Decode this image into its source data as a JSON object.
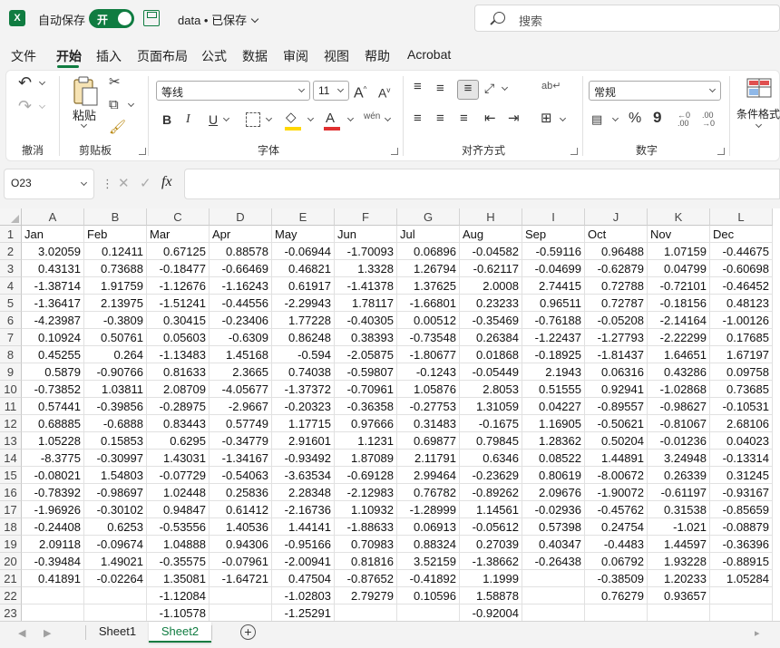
{
  "titlebar": {
    "app_icon": "excel-icon",
    "autosave_label": "自动保存",
    "toggle_label": "开",
    "doc_title": "data • 已保存",
    "search_placeholder": "搜索"
  },
  "menu": [
    "文件",
    "开始",
    "插入",
    "页面布局",
    "公式",
    "数据",
    "审阅",
    "视图",
    "帮助",
    "Acrobat"
  ],
  "ribbon": {
    "groups": {
      "undo": "撤消",
      "clipboard": "剪贴板",
      "font": "字体",
      "alignment": "对齐方式",
      "number": "数字"
    },
    "paste_label": "粘贴",
    "font_name": "等线",
    "font_size": "11",
    "number_format": "常规",
    "conditional_format": "条件格式",
    "bold": "B",
    "italic": "I",
    "underline": "U",
    "phonetic": "wén",
    "percent": "%",
    "comma": "9",
    "font_grow": "A",
    "font_shrink": "A",
    "font_color_glyph": "A",
    "decimal_increase": "←0 .00",
    "decimal_decrease": ".00 →0",
    "wrap_glyph": "ab"
  },
  "formula_bar": {
    "name_box": "O23",
    "fx_label": "fx",
    "formula": ""
  },
  "grid": {
    "columns": [
      "A",
      "B",
      "C",
      "D",
      "E",
      "F",
      "G",
      "H",
      "I",
      "J",
      "K",
      "L"
    ],
    "row_numbers": [
      "1",
      "2",
      "3",
      "4",
      "5",
      "6",
      "7",
      "8",
      "9",
      "10",
      "11",
      "12",
      "13",
      "14",
      "15",
      "16",
      "17",
      "18",
      "19",
      "20",
      "21",
      "22",
      "23"
    ],
    "header_row": [
      "Jan",
      "Feb",
      "Mar",
      "Apr",
      "May",
      "Jun",
      "Jul",
      "Aug",
      "Sep",
      "Oct",
      "Nov",
      "Dec"
    ],
    "rows": [
      [
        "3.02059",
        "0.12411",
        "0.67125",
        "0.88578",
        "-0.06944",
        "-1.70093",
        "0.06896",
        "-0.04582",
        "-0.59116",
        "0.96488",
        "1.07159",
        "-0.44675"
      ],
      [
        "0.43131",
        "0.73688",
        "-0.18477",
        "-0.66469",
        "0.46821",
        "1.3328",
        "1.26794",
        "-0.62117",
        "-0.04699",
        "-0.62879",
        "0.04799",
        "-0.60698"
      ],
      [
        "-1.38714",
        "1.91759",
        "-1.12676",
        "-1.16243",
        "0.61917",
        "-1.41378",
        "1.37625",
        "2.0008",
        "2.74415",
        "0.72788",
        "-0.72101",
        "-0.46452"
      ],
      [
        "-1.36417",
        "2.13975",
        "-1.51241",
        "-0.44556",
        "-2.29943",
        "1.78117",
        "-1.66801",
        "0.23233",
        "0.96511",
        "0.72787",
        "-0.18156",
        "0.48123"
      ],
      [
        "-4.23987",
        "-0.3809",
        "0.30415",
        "-0.23406",
        "1.77228",
        "-0.40305",
        "0.00512",
        "-0.35469",
        "-0.76188",
        "-0.05208",
        "-2.14164",
        "-1.00126"
      ],
      [
        "0.10924",
        "0.50761",
        "0.05603",
        "-0.6309",
        "0.86248",
        "0.38393",
        "-0.73548",
        "0.26384",
        "-1.22437",
        "-1.27793",
        "-2.22299",
        "0.17685"
      ],
      [
        "0.45255",
        "0.264",
        "-1.13483",
        "1.45168",
        "-0.594",
        "-2.05875",
        "-1.80677",
        "0.01868",
        "-0.18925",
        "-1.81437",
        "1.64651",
        "1.67197"
      ],
      [
        "0.5879",
        "-0.90766",
        "0.81633",
        "2.3665",
        "0.74038",
        "-0.59807",
        "-0.1243",
        "-0.05449",
        "2.1943",
        "0.06316",
        "0.43286",
        "0.09758"
      ],
      [
        "-0.73852",
        "1.03811",
        "2.08709",
        "-4.05677",
        "-1.37372",
        "-0.70961",
        "1.05876",
        "2.8053",
        "0.51555",
        "0.92941",
        "-1.02868",
        "0.73685"
      ],
      [
        "0.57441",
        "-0.39856",
        "-0.28975",
        "-2.9667",
        "-0.20323",
        "-0.36358",
        "-0.27753",
        "1.31059",
        "0.04227",
        "-0.89557",
        "-0.98627",
        "-0.10531"
      ],
      [
        "0.68885",
        "-0.6888",
        "0.83443",
        "0.57749",
        "1.17715",
        "0.97666",
        "0.31483",
        "-0.1675",
        "1.16905",
        "-0.50621",
        "-0.81067",
        "2.68106"
      ],
      [
        "1.05228",
        "0.15853",
        "0.6295",
        "-0.34779",
        "2.91601",
        "1.1231",
        "0.69877",
        "0.79845",
        "1.28362",
        "0.50204",
        "-0.01236",
        "0.04023"
      ],
      [
        "-8.3775",
        "-0.30997",
        "1.43031",
        "-1.34167",
        "-0.93492",
        "1.87089",
        "2.11791",
        "0.6346",
        "0.08522",
        "1.44891",
        "3.24948",
        "-0.13314"
      ],
      [
        "-0.08021",
        "1.54803",
        "-0.07729",
        "-0.54063",
        "-3.63534",
        "-0.69128",
        "2.99464",
        "-0.23629",
        "0.80619",
        "-8.00672",
        "0.26339",
        "0.31245"
      ],
      [
        "-0.78392",
        "-0.98697",
        "1.02448",
        "0.25836",
        "2.28348",
        "-2.12983",
        "0.76782",
        "-0.89262",
        "2.09676",
        "-1.90072",
        "-0.61197",
        "-0.93167"
      ],
      [
        "-1.96926",
        "-0.30102",
        "0.94847",
        "0.61412",
        "-2.16736",
        "1.10932",
        "-1.28999",
        "1.14561",
        "-0.02936",
        "-0.45762",
        "0.31538",
        "-0.85659"
      ],
      [
        "-0.24408",
        "0.6253",
        "-0.53556",
        "1.40536",
        "1.44141",
        "-1.88633",
        "0.06913",
        "-0.05612",
        "0.57398",
        "0.24754",
        "-1.021",
        "-0.08879"
      ],
      [
        "2.09118",
        "-0.09674",
        "1.04888",
        "0.94306",
        "-0.95166",
        "0.70983",
        "0.88324",
        "0.27039",
        "0.40347",
        "-0.4483",
        "1.44597",
        "-0.36396"
      ],
      [
        "-0.39484",
        "1.49021",
        "-0.35575",
        "-0.07961",
        "-2.00941",
        "0.81816",
        "3.52159",
        "-1.38662",
        "-0.26438",
        "0.06792",
        "1.93228",
        "-0.88915"
      ],
      [
        "0.41891",
        "-0.02264",
        "1.35081",
        "-1.64721",
        "0.47504",
        "-0.87652",
        "-0.41892",
        "1.1999",
        "",
        "-0.38509",
        "1.20233",
        "1.05284"
      ],
      [
        "",
        "",
        "-1.12084",
        "",
        "-1.02803",
        "2.79279",
        "0.10596",
        "1.58878",
        "",
        "0.76279",
        "0.93657",
        ""
      ],
      [
        "",
        "",
        "-1.10578",
        "",
        "-1.25291",
        "",
        "",
        "-0.92004",
        "",
        "",
        "",
        ""
      ]
    ]
  },
  "sheets": [
    "Sheet1",
    "Sheet2"
  ],
  "active_sheet": "Sheet2",
  "colors": {
    "accent": "#107c41",
    "ribbon_bg": "#ffffff",
    "window_bg": "#f3f3f3"
  }
}
